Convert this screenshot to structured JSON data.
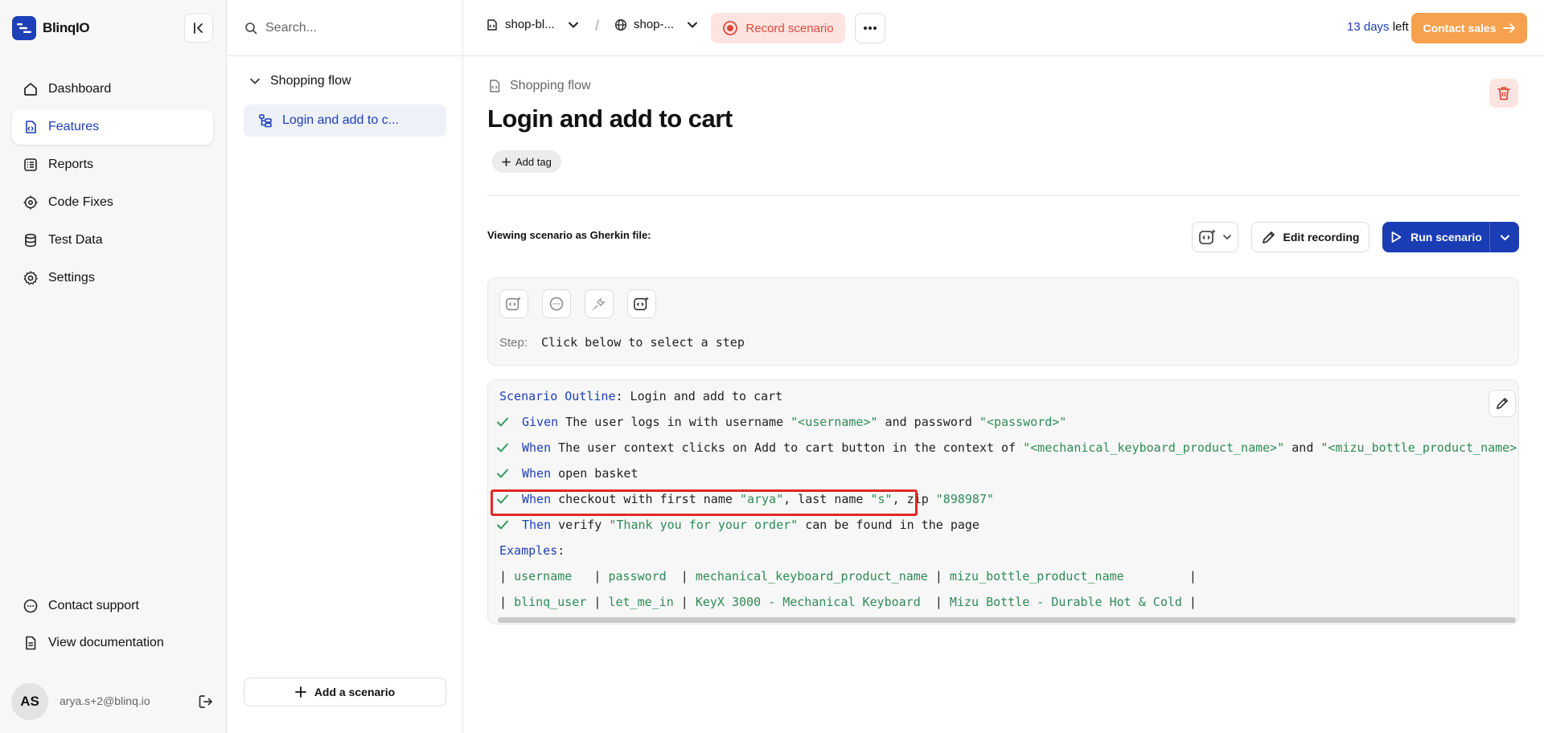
{
  "app": {
    "name": "BlinqIO"
  },
  "sidebar": {
    "items": [
      {
        "label": "Dashboard",
        "icon": "home-icon"
      },
      {
        "label": "Features",
        "icon": "feature-icon",
        "active": true
      },
      {
        "label": "Reports",
        "icon": "report-icon"
      },
      {
        "label": "Code Fixes",
        "icon": "code-fix-icon"
      },
      {
        "label": "Test Data",
        "icon": "database-icon"
      },
      {
        "label": "Settings",
        "icon": "gear-icon"
      }
    ],
    "bottom": [
      {
        "label": "Contact support",
        "icon": "chat-icon"
      },
      {
        "label": "View documentation",
        "icon": "document-icon"
      }
    ],
    "user": {
      "initials": "AS",
      "email": "arya.s+2@blinq.io"
    }
  },
  "tree": {
    "search_placeholder": "Search...",
    "folder": "Shopping flow",
    "scenario": "Login and add to c...",
    "add_scenario": "Add a scenario"
  },
  "topbar": {
    "project": "shop-bl...",
    "environment": "shop-...",
    "separator": "/",
    "record": "Record scenario",
    "trial_days": "13 days",
    "trial_suffix": " left",
    "contact_sales": "Contact sales"
  },
  "main": {
    "feature": "Shopping flow",
    "title": "Login and add to cart",
    "add_tag": "Add tag",
    "viewing_label": "Viewing scenario as Gherkin file:",
    "edit_recording": "Edit recording",
    "run_scenario": "Run scenario",
    "step_label": "Step:",
    "step_text": "Click below to select a step"
  },
  "gherkin": {
    "outline_kw": "Scenario Outline",
    "outline_title": ": Login and add to cart",
    "steps": [
      {
        "kw": "Given",
        "parts": [
          " The user logs in with username ",
          "\"<username>\"",
          " and password ",
          "\"<password>\""
        ]
      },
      {
        "kw": "When",
        "parts": [
          " The user context clicks on Add to cart button in the context of ",
          "\"<mechanical_keyboard_product_name>\"",
          " and ",
          "\"<mizu_bottle_product_name>\""
        ]
      },
      {
        "kw": "When",
        "parts": [
          " open basket"
        ]
      },
      {
        "kw": "When",
        "parts": [
          " checkout with first name ",
          "\"arya\"",
          ", last name ",
          "\"s\"",
          ", zip ",
          "\"898987\""
        ]
      },
      {
        "kw": "Then",
        "parts": [
          " verify ",
          "\"Thank you for your order\"",
          " can be found in the page"
        ]
      }
    ],
    "examples_kw": "Examples",
    "examples_colon": ":",
    "header": [
      "username  ",
      "password ",
      "mechanical_keyboard_product_name",
      "mizu_bottle_product_name        "
    ],
    "row": [
      "blinq_user",
      "let_me_in",
      "KeyX 3000 - Mechanical Keyboard ",
      "Mizu Bottle - Durable Hot & Cold"
    ]
  },
  "colors": {
    "brand": "#1d3fb8",
    "string": "#2e8b57",
    "record": "#e0483a",
    "contact_sales": "#f5a14e",
    "highlight": "#e02828"
  }
}
